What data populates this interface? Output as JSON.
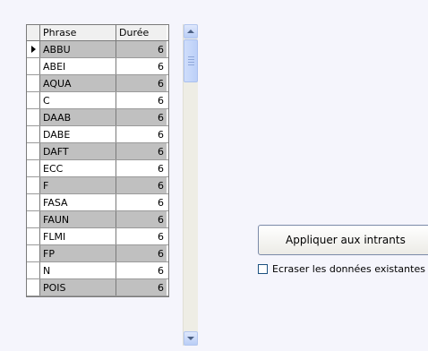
{
  "grid": {
    "columns": [
      "Phrase",
      "Durée"
    ],
    "rows": [
      {
        "phrase": "ABBU",
        "duree": "6",
        "current": true
      },
      {
        "phrase": "ABEI",
        "duree": "6"
      },
      {
        "phrase": "AQUA",
        "duree": "6"
      },
      {
        "phrase": "C",
        "duree": "6"
      },
      {
        "phrase": "DAAB",
        "duree": "6"
      },
      {
        "phrase": "DABE",
        "duree": "6"
      },
      {
        "phrase": "DAFT",
        "duree": "6"
      },
      {
        "phrase": "ECC",
        "duree": "6"
      },
      {
        "phrase": "F",
        "duree": "6"
      },
      {
        "phrase": "FASA",
        "duree": "6"
      },
      {
        "phrase": "FAUN",
        "duree": "6"
      },
      {
        "phrase": "FLMI",
        "duree": "6"
      },
      {
        "phrase": "FP",
        "duree": "6"
      },
      {
        "phrase": "N",
        "duree": "6"
      },
      {
        "phrase": "POIS",
        "duree": "6"
      }
    ]
  },
  "actions": {
    "apply_label": "Appliquer aux intrants",
    "overwrite_label": "Ecraser les données existantes",
    "overwrite_checked": false
  },
  "colors": {
    "alt_row": "#c0c0c0",
    "background": "#f5f5fc"
  }
}
